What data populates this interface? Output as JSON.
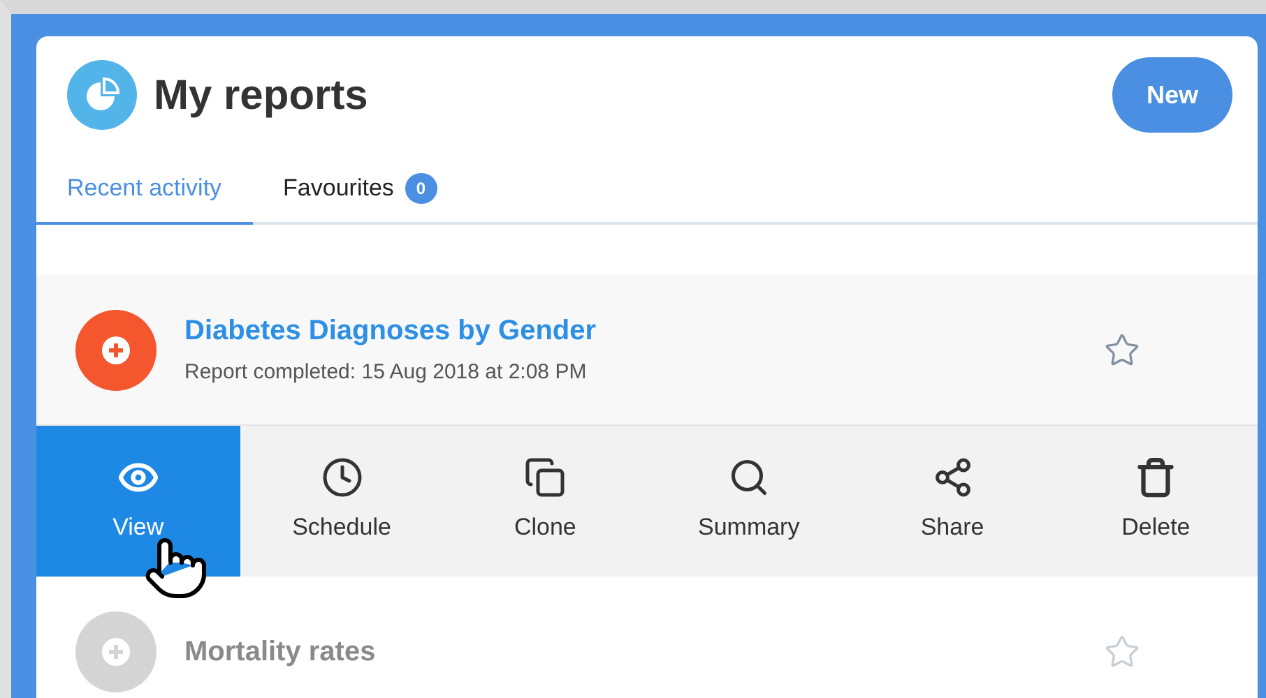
{
  "header": {
    "title": "My reports",
    "new_button": "New"
  },
  "tabs": [
    {
      "label": "Recent activity",
      "selected": true
    },
    {
      "label": "Favourites",
      "selected": false,
      "count": "0"
    }
  ],
  "reports": [
    {
      "title": "Diabetes Diagnoses by Gender",
      "subtitle": "Report completed: 15 Aug 2018 at 2:08 PM",
      "color": "#f4572e",
      "starred": false,
      "expanded": true,
      "faded": false,
      "actions": [
        {
          "kind": "view",
          "label": "View",
          "selected": true
        },
        {
          "kind": "schedule",
          "label": "Schedule",
          "selected": false
        },
        {
          "kind": "clone",
          "label": "Clone",
          "selected": false
        },
        {
          "kind": "summary",
          "label": "Summary",
          "selected": false
        },
        {
          "kind": "share",
          "label": "Share",
          "selected": false
        },
        {
          "kind": "delete",
          "label": "Delete",
          "selected": false
        }
      ]
    },
    {
      "title": "Mortality rates",
      "color": "#d4d4d4",
      "starred": false,
      "expanded": false,
      "faded": true
    }
  ]
}
